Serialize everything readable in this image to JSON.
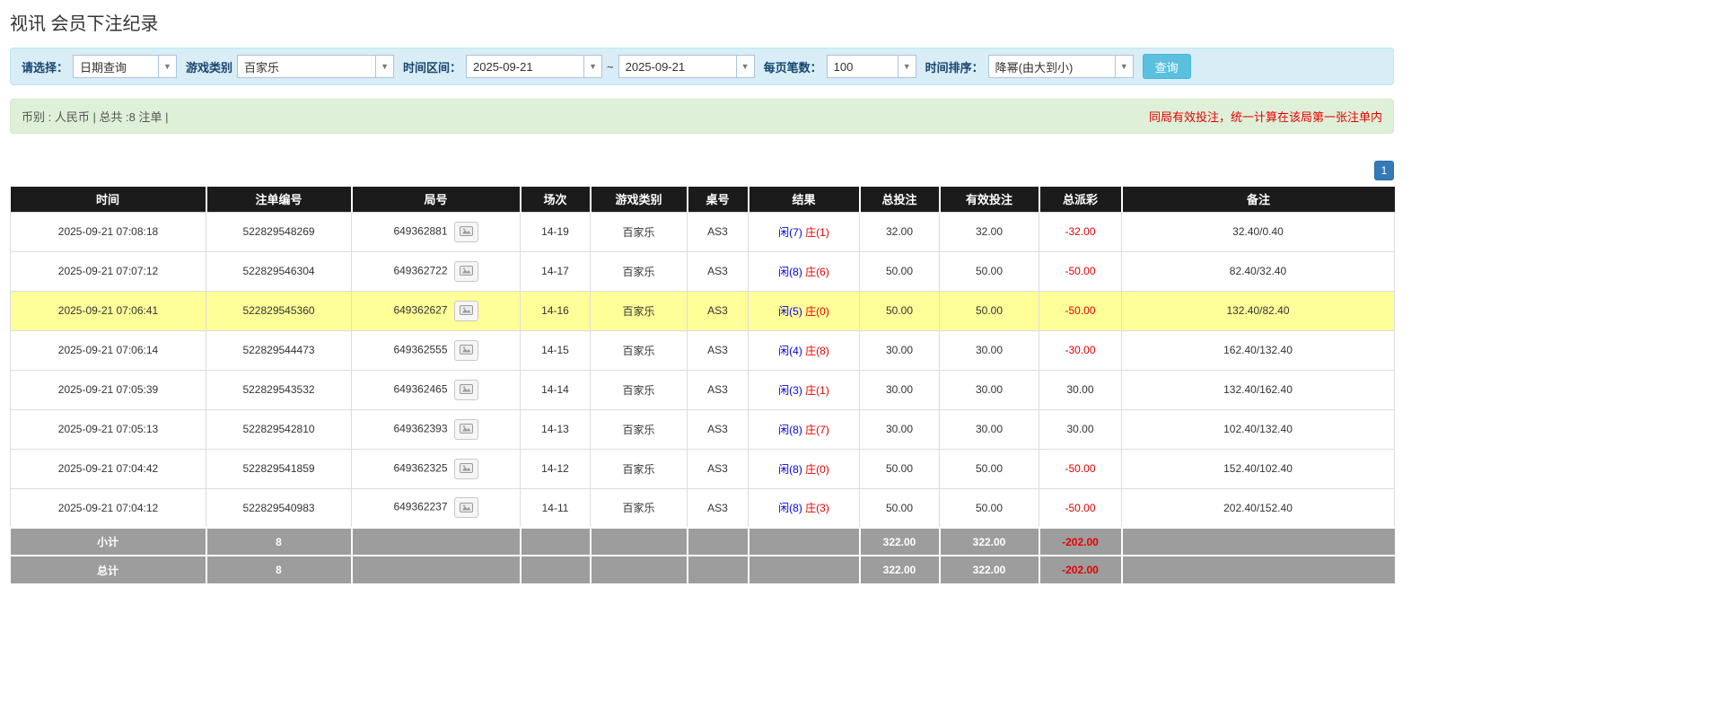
{
  "page": {
    "title": "视讯 会员下注纪录"
  },
  "icons": {
    "chevron_down": "▼"
  },
  "filters": {
    "select_label": "请选择：",
    "select_value": "日期查询",
    "game_type_label": "游戏类别",
    "game_type_value": "百家乐",
    "date_range_label": "时间区间：",
    "date_from": "2025-09-21",
    "date_separator": "~",
    "date_to": "2025-09-21",
    "page_size_label": "每页笔数：",
    "page_size_value": "100",
    "sort_label": "时间排序：",
    "sort_value": "降幂(由大到小)",
    "search_button": "查询"
  },
  "summary": {
    "left": "币别 : 人民币 | 总共 :8 注单 |",
    "right": "同局有效投注，统一计算在该局第一张注单内"
  },
  "pagination": {
    "current": "1"
  },
  "table": {
    "headers": [
      "时间",
      "注单编号",
      "局号",
      "场次",
      "游戏类别",
      "桌号",
      "结果",
      "总投注",
      "有效投注",
      "总派彩",
      "备注"
    ],
    "rows": [
      {
        "time": "2025-09-21 07:08:18",
        "bet_id": "522829548269",
        "round_id": "649362881",
        "session": "14-19",
        "game": "百家乐",
        "table_no": "AS3",
        "result_player": "闲(7)",
        "result_banker": "庄(1)",
        "total_bet": "32.00",
        "valid_bet": "32.00",
        "payout": "-32.00",
        "remark": "32.40/0.40",
        "highlight": false
      },
      {
        "time": "2025-09-21 07:07:12",
        "bet_id": "522829546304",
        "round_id": "649362722",
        "session": "14-17",
        "game": "百家乐",
        "table_no": "AS3",
        "result_player": "闲(8)",
        "result_banker": "庄(6)",
        "total_bet": "50.00",
        "valid_bet": "50.00",
        "payout": "-50.00",
        "remark": "82.40/32.40",
        "highlight": false
      },
      {
        "time": "2025-09-21 07:06:41",
        "bet_id": "522829545360",
        "round_id": "649362627",
        "session": "14-16",
        "game": "百家乐",
        "table_no": "AS3",
        "result_player": "闲(5)",
        "result_banker": "庄(0)",
        "total_bet": "50.00",
        "valid_bet": "50.00",
        "payout": "-50.00",
        "remark": "132.40/82.40",
        "highlight": true
      },
      {
        "time": "2025-09-21 07:06:14",
        "bet_id": "522829544473",
        "round_id": "649362555",
        "session": "14-15",
        "game": "百家乐",
        "table_no": "AS3",
        "result_player": "闲(4)",
        "result_banker": "庄(8)",
        "total_bet": "30.00",
        "valid_bet": "30.00",
        "payout": "-30.00",
        "remark": "162.40/132.40",
        "highlight": false
      },
      {
        "time": "2025-09-21 07:05:39",
        "bet_id": "522829543532",
        "round_id": "649362465",
        "session": "14-14",
        "game": "百家乐",
        "table_no": "AS3",
        "result_player": "闲(3)",
        "result_banker": "庄(1)",
        "total_bet": "30.00",
        "valid_bet": "30.00",
        "payout": "30.00",
        "remark": "132.40/162.40",
        "highlight": false
      },
      {
        "time": "2025-09-21 07:05:13",
        "bet_id": "522829542810",
        "round_id": "649362393",
        "session": "14-13",
        "game": "百家乐",
        "table_no": "AS3",
        "result_player": "闲(8)",
        "result_banker": "庄(7)",
        "total_bet": "30.00",
        "valid_bet": "30.00",
        "payout": "30.00",
        "remark": "102.40/132.40",
        "highlight": false
      },
      {
        "time": "2025-09-21 07:04:42",
        "bet_id": "522829541859",
        "round_id": "649362325",
        "session": "14-12",
        "game": "百家乐",
        "table_no": "AS3",
        "result_player": "闲(8)",
        "result_banker": "庄(0)",
        "total_bet": "50.00",
        "valid_bet": "50.00",
        "payout": "-50.00",
        "remark": "152.40/102.40",
        "highlight": false
      },
      {
        "time": "2025-09-21 07:04:12",
        "bet_id": "522829540983",
        "round_id": "649362237",
        "session": "14-11",
        "game": "百家乐",
        "table_no": "AS3",
        "result_player": "闲(8)",
        "result_banker": "庄(3)",
        "total_bet": "50.00",
        "valid_bet": "50.00",
        "payout": "-50.00",
        "remark": "202.40/152.40",
        "highlight": false
      }
    ],
    "subtotal": {
      "label": "小计",
      "count": "8",
      "total_bet": "322.00",
      "valid_bet": "322.00",
      "payout": "-202.00"
    },
    "total": {
      "label": "总计",
      "count": "8",
      "total_bet": "322.00",
      "valid_bet": "322.00",
      "payout": "-202.00"
    }
  }
}
